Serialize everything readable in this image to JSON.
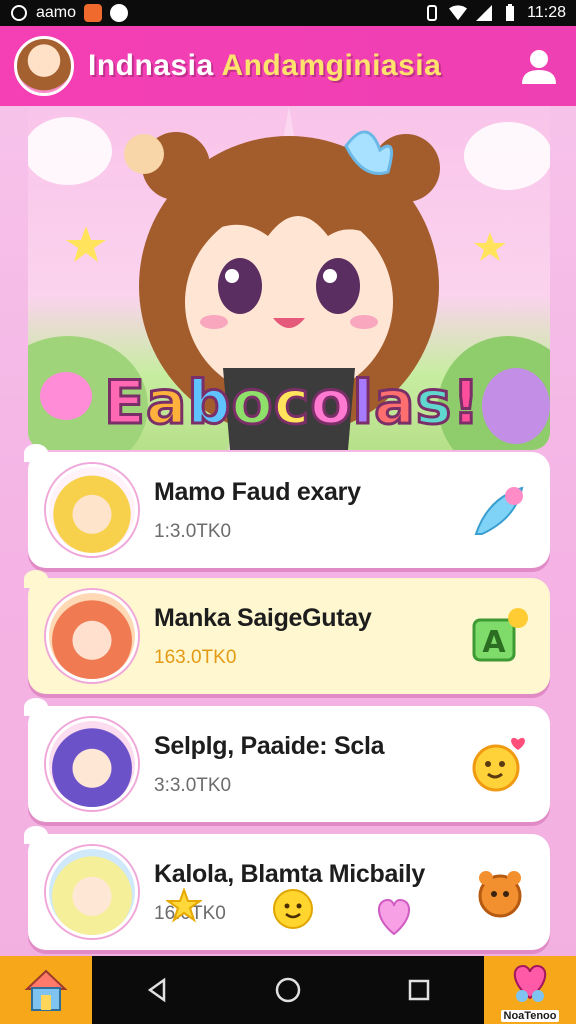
{
  "status_bar": {
    "carrier": "aamo",
    "time": "11:28"
  },
  "app_bar": {
    "title_part1": "Indnasia",
    "title_part2": "Andamginiasia"
  },
  "hero": {
    "headline_letters": [
      "E",
      "a",
      "b",
      "o",
      "c",
      "o",
      "l",
      "a",
      "s",
      "!"
    ]
  },
  "cards": [
    {
      "title": "Mamo Faud exary",
      "subtitle": "1:3.0TK0",
      "style": "white"
    },
    {
      "title": "Manka SaigeGutay",
      "subtitle": "163.0TK0",
      "style": "yellow"
    },
    {
      "title": "Selplg, Paaide: Scla",
      "subtitle": "3:3.0TK0",
      "style": "white"
    },
    {
      "title": "Kalola, Blamta Micbaily",
      "subtitle": "16.0TK0",
      "style": "white"
    }
  ],
  "nav": {
    "right_label": "NoaTenoo"
  },
  "colors": {
    "accent_pink": "#f53fb4",
    "nav_orange": "#f7a81a",
    "background": "#f7c6ec"
  },
  "icons": {
    "status": [
      "camera-icon",
      "notification-icon",
      "compass-icon",
      "vibrate-icon",
      "wifi-icon",
      "signal-icon",
      "battery-icon"
    ],
    "nav": [
      "home-icon",
      "back-icon",
      "home-circle-icon",
      "recents-icon",
      "heart-icon"
    ]
  }
}
